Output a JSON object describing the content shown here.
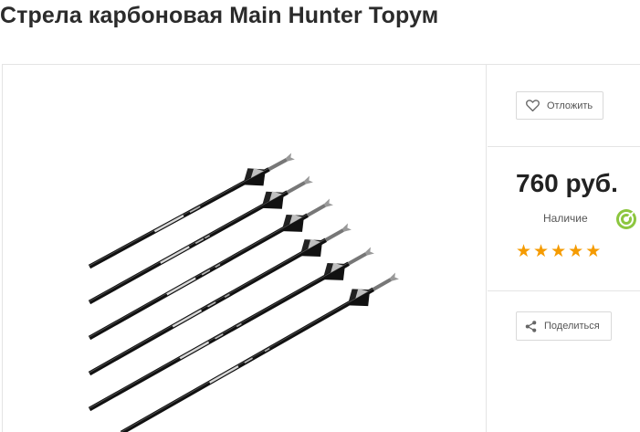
{
  "product": {
    "title": "Стрела карбоновая Main Hunter Торум",
    "image_alt": "arrows-product-image",
    "price": "760 руб.",
    "availability": "Наличие",
    "rating_stars": 5,
    "wish_label": "Отложить",
    "share_label": "Поделиться"
  },
  "icons": {
    "wish": "heart-icon",
    "availability": "target-icon",
    "share": "share-icon",
    "rating": "star-icon"
  },
  "colors": {
    "star": "#f59b00",
    "availability_icon": "#8cc63f",
    "border": "#e4e4e4"
  }
}
